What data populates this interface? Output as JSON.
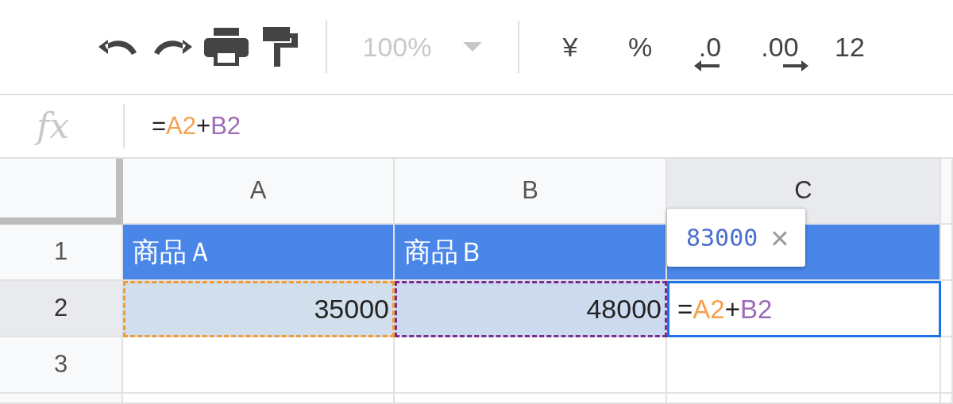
{
  "toolbar": [
    [
      {
        "kind": "undo",
        "disabled": false
      },
      {
        "kind": "redo",
        "disabled": false
      },
      {
        "kind": "print",
        "disabled": false
      },
      {
        "kind": "paint-format",
        "disabled": false
      }
    ],
    [
      {
        "kind": "zoom",
        "label": "100%",
        "disabled": true
      }
    ],
    [
      {
        "kind": "text",
        "label": "¥",
        "disabled": false
      },
      {
        "kind": "text",
        "label": "%",
        "disabled": false
      },
      {
        "kind": "decimal-decrease",
        "label": ".0",
        "disabled": false
      },
      {
        "kind": "decimal-increase",
        "label": ".00",
        "disabled": false
      },
      {
        "kind": "text",
        "label": "12",
        "disabled": false
      }
    ]
  ],
  "formula_bar": {
    "label": "fx",
    "formula": [
      {
        "text": "="
      },
      {
        "text": "A2",
        "color": "#f6a04d"
      },
      {
        "text": "+"
      },
      {
        "text": "B2",
        "color": "#9c6bb5"
      }
    ]
  },
  "sheet": {
    "columns": [
      {
        "label": "A",
        "selected": false
      },
      {
        "label": "B",
        "selected": false
      },
      {
        "label": "C",
        "selected": true
      }
    ],
    "rows": [
      {
        "label": "1",
        "selected": false,
        "cells": [
          {
            "kind": "header",
            "text": "商品Ａ"
          },
          {
            "kind": "header",
            "text": "商品Ｂ"
          },
          {
            "kind": "header"
          }
        ]
      },
      {
        "label": "2",
        "selected": true,
        "cells": [
          {
            "kind": "number",
            "text": "35000",
            "color": "#f39a34"
          },
          {
            "kind": "number",
            "text": "48000",
            "color": "#7b2c8f"
          },
          {
            "kind": "editing",
            "formula": [
              {
                "text": "="
              },
              {
                "text": "A2",
                "color": "#f6a04d"
              },
              {
                "text": "+"
              },
              {
                "text": "B2",
                "color": "#9c6bb5"
              }
            ]
          }
        ]
      },
      {
        "label": "3",
        "selected": false,
        "cells": [
          {
            "kind": "empty"
          },
          {
            "kind": "empty"
          },
          {
            "kind": "empty"
          }
        ]
      }
    ],
    "tooltip": {
      "value": "83000",
      "close": "×"
    }
  }
}
